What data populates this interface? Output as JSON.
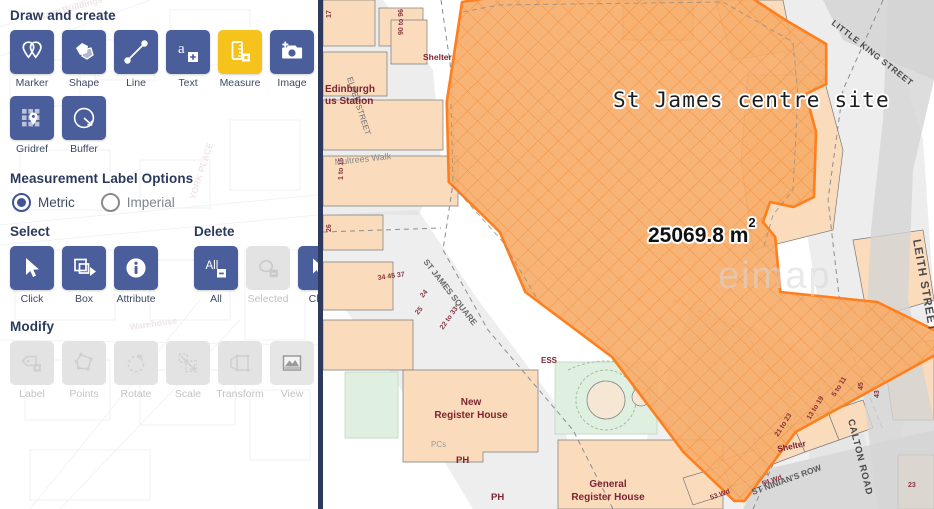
{
  "sidebar": {
    "draw": {
      "title": "Draw and create",
      "tools": [
        {
          "label": "Marker",
          "icon": "marker-pins-icon",
          "state": "enabled"
        },
        {
          "label": "Shape",
          "icon": "shape-polygon-icon",
          "state": "enabled"
        },
        {
          "label": "Line",
          "icon": "line-icon",
          "state": "enabled"
        },
        {
          "label": "Text",
          "icon": "text-add-icon",
          "state": "enabled"
        },
        {
          "label": "Measure",
          "icon": "ruler-measure-icon",
          "state": "active"
        },
        {
          "label": "Image",
          "icon": "camera-add-icon",
          "state": "enabled"
        },
        {
          "label": "Gridref",
          "icon": "gridref-pin-icon",
          "state": "enabled"
        },
        {
          "label": "Buffer",
          "icon": "buffer-radius-icon",
          "state": "enabled"
        }
      ]
    },
    "measurement": {
      "title": "Measurement Label Options",
      "options": [
        {
          "label": "Metric",
          "selected": true
        },
        {
          "label": "Imperial",
          "selected": false
        }
      ]
    },
    "select": {
      "title": "Select",
      "tools": [
        {
          "label": "Click",
          "icon": "cursor-click-icon",
          "state": "enabled"
        },
        {
          "label": "Box",
          "icon": "select-box-icon",
          "state": "enabled"
        },
        {
          "label": "Attribute",
          "icon": "info-attribute-icon",
          "state": "enabled"
        }
      ]
    },
    "delete": {
      "title": "Delete",
      "tools": [
        {
          "label": "All",
          "icon": "delete-all-icon",
          "state": "enabled"
        },
        {
          "label": "Selected",
          "icon": "delete-selected-icon",
          "state": "disabled"
        },
        {
          "label": "Click",
          "icon": "delete-click-icon",
          "state": "enabled"
        }
      ]
    },
    "modify": {
      "title": "Modify",
      "tools": [
        {
          "label": "Label",
          "icon": "label-tag-icon",
          "state": "disabled"
        },
        {
          "label": "Points",
          "icon": "edit-points-icon",
          "state": "disabled"
        },
        {
          "label": "Rotate",
          "icon": "rotate-icon",
          "state": "disabled"
        },
        {
          "label": "Scale",
          "icon": "scale-icon",
          "state": "disabled"
        },
        {
          "label": "Transform",
          "icon": "transform-icon",
          "state": "disabled"
        },
        {
          "label": "View",
          "icon": "view-image-icon",
          "state": "disabled"
        }
      ]
    }
  },
  "map": {
    "site_label": "St James centre site",
    "area_value": "25069.8 m",
    "area_unit_superscript": "2",
    "watermark": "eimap",
    "street_labels": [
      {
        "text": "LEITH STREET"
      },
      {
        "text": "LITTLE KING STREET"
      },
      {
        "text": "CALTON ROAD"
      },
      {
        "text": "ST NINIAN'S ROW"
      },
      {
        "text": "ST JAMES SQUARE"
      },
      {
        "text": "ELDER STREET"
      },
      {
        "text": "Multrees Walk"
      }
    ],
    "building_labels": [
      {
        "text": "New Register House"
      },
      {
        "text": "General Register House"
      },
      {
        "text": "Edinburgh Bus Station"
      },
      {
        "text": "Shelter"
      },
      {
        "text": "PH"
      },
      {
        "text": "ESS"
      },
      {
        "text": "PCs"
      }
    ],
    "colors": {
      "polygon_fill": "#f7ad6a",
      "polygon_stroke": "#ff7f1f",
      "building": "#fadcbd",
      "road": "#dcdcdc",
      "green": "#dff0e0",
      "label_red": "#7d2431"
    }
  }
}
